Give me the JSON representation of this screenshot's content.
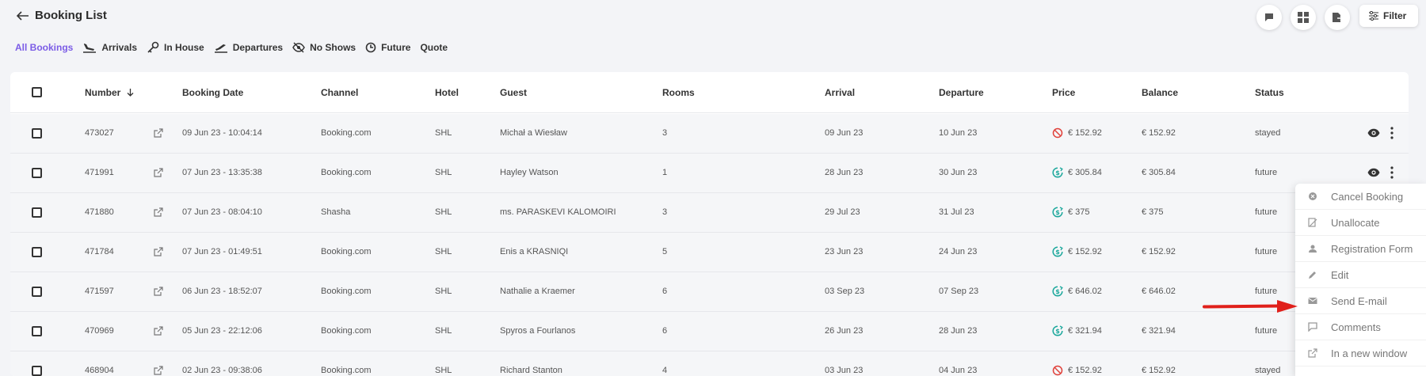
{
  "header": {
    "title": "Booking List",
    "filter_label": "Filter"
  },
  "tabs": [
    {
      "label": "All Bookings",
      "icon": "list-icon",
      "active": true
    },
    {
      "label": "Arrivals",
      "icon": "plane-landing-icon"
    },
    {
      "label": "In House",
      "icon": "key-icon"
    },
    {
      "label": "Departures",
      "icon": "plane-takeoff-icon"
    },
    {
      "label": "No Shows",
      "icon": "eye-off-icon"
    },
    {
      "label": "Future",
      "icon": "clock-icon"
    },
    {
      "label": "Quote",
      "icon": ""
    }
  ],
  "table": {
    "columns": [
      "Number",
      "Booking Date",
      "Channel",
      "Hotel",
      "Guest",
      "Rooms",
      "Arrival",
      "Departure",
      "Price",
      "Balance",
      "Status"
    ],
    "rows": [
      {
        "number": "473027",
        "date": "09 Jun 23 - 10:04:14",
        "channel": "Booking.com",
        "hotel": "SHL",
        "guest": "Michał a Wiesław",
        "rooms": "3",
        "arrival": "09 Jun 23",
        "departure": "10 Jun 23",
        "price_icon": "not-paid-icon",
        "price": "€ 152.92",
        "balance": "€ 152.92",
        "status": "stayed"
      },
      {
        "number": "471991",
        "date": "07 Jun 23 - 13:35:38",
        "channel": "Booking.com",
        "hotel": "SHL",
        "guest": "Hayley Watson",
        "rooms": "1",
        "arrival": "28 Jun 23",
        "departure": "30 Jun 23",
        "price_icon": "paid-icon",
        "price": "€ 305.84",
        "balance": "€ 305.84",
        "status": "future"
      },
      {
        "number": "471880",
        "date": "07 Jun 23 - 08:04:10",
        "channel": "Shasha",
        "hotel": "SHL",
        "guest": "ms. PARASKEVI KALOMOIRI",
        "rooms": "3",
        "arrival": "29 Jul 23",
        "departure": "31 Jul 23",
        "price_icon": "paid-icon",
        "price": "€ 375",
        "balance": "€ 375",
        "status": "future"
      },
      {
        "number": "471784",
        "date": "07 Jun 23 - 01:49:51",
        "channel": "Booking.com",
        "hotel": "SHL",
        "guest": "Enis a KRASNIQI",
        "rooms": "5",
        "arrival": "23 Jun 23",
        "departure": "24 Jun 23",
        "price_icon": "paid-icon",
        "price": "€ 152.92",
        "balance": "€ 152.92",
        "status": "future"
      },
      {
        "number": "471597",
        "date": "06 Jun 23 - 18:52:07",
        "channel": "Booking.com",
        "hotel": "SHL",
        "guest": "Nathalie a Kraemer",
        "rooms": "6",
        "arrival": "03 Sep 23",
        "departure": "07 Sep 23",
        "price_icon": "paid-icon",
        "price": "€ 646.02",
        "balance": "€ 646.02",
        "status": "future"
      },
      {
        "number": "470969",
        "date": "05 Jun 23 - 22:12:06",
        "channel": "Booking.com",
        "hotel": "SHL",
        "guest": "Spyros a Fourlanos",
        "rooms": "6",
        "arrival": "26 Jun 23",
        "departure": "28 Jun 23",
        "price_icon": "paid-icon",
        "price": "€ 321.94",
        "balance": "€ 321.94",
        "status": "future"
      },
      {
        "number": "468904",
        "date": "02 Jun 23 - 09:38:06",
        "channel": "Booking.com",
        "hotel": "SHL",
        "guest": "Richard Stanton",
        "rooms": "4",
        "arrival": "03 Jun 23",
        "departure": "04 Jun 23",
        "price_icon": "not-paid-icon",
        "price": "€ 152.92",
        "balance": "€ 152.92",
        "status": "stayed"
      }
    ]
  },
  "context_menu": [
    {
      "label": "Cancel Booking",
      "icon": "cancel-icon"
    },
    {
      "label": "Unallocate",
      "icon": "unallocate-icon"
    },
    {
      "label": "Registration Form",
      "icon": "user-form-icon"
    },
    {
      "label": "Edit",
      "icon": "pencil-icon"
    },
    {
      "label": "Send E-mail",
      "icon": "mail-icon"
    },
    {
      "label": "Comments",
      "icon": "comment-icon"
    },
    {
      "label": "In a new window",
      "icon": "external-link-icon"
    }
  ],
  "colors": {
    "accent": "#7b5ce6",
    "paid": "#1aa79b",
    "not_paid": "#e0413a",
    "arrow": "#e0201b"
  }
}
